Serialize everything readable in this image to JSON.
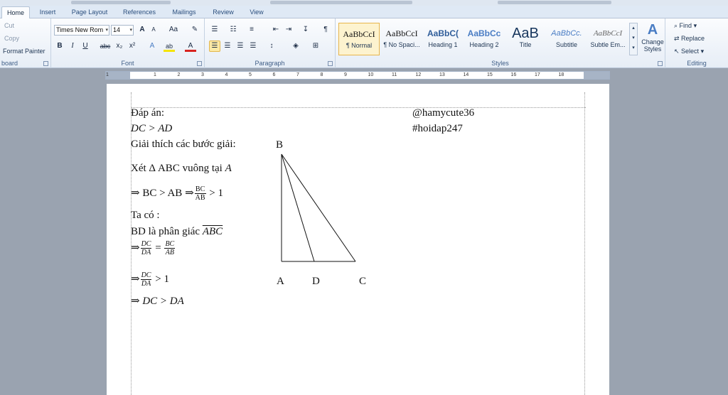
{
  "tabs": [
    "Home",
    "Insert",
    "Page Layout",
    "References",
    "Mailings",
    "Review",
    "View"
  ],
  "clipboard": {
    "cut": "Cut",
    "copy": "Copy",
    "format_painter": "Format Painter",
    "label": "board"
  },
  "font": {
    "name": "Times New Rom",
    "size": "14",
    "label": "Font",
    "grow": "A",
    "shrink": "A",
    "case": "Aa",
    "bold": "B",
    "italic": "I",
    "underline": "U",
    "strike": "abc",
    "subscript": "x₂",
    "superscript": "x²",
    "effects": "A",
    "highlight": "ab",
    "color": "A"
  },
  "paragraph": {
    "label": "Paragraph",
    "pilcrow": "¶"
  },
  "styles": {
    "label": "Styles",
    "items": [
      {
        "preview": "AaBbCcI",
        "name": "¶ Normal"
      },
      {
        "preview": "AaBbCcI",
        "name": "¶ No Spaci..."
      },
      {
        "preview": "AaBbC(",
        "name": "Heading 1"
      },
      {
        "preview": "AaBbCc",
        "name": "Heading 2"
      },
      {
        "preview": "AaB",
        "name": "Title"
      },
      {
        "preview": "AaBbCc.",
        "name": "Subtitle"
      },
      {
        "preview": "AaBbCcI",
        "name": "Subtle Em..."
      }
    ],
    "change": "Change Styles"
  },
  "editing": {
    "label": "Editing",
    "find": "Find",
    "replace": "Replace",
    "select": "Select"
  },
  "ruler": {
    "ticks": [
      "1",
      "1",
      "2",
      "3",
      "4",
      "5",
      "6",
      "7",
      "8",
      "9",
      "10",
      "11",
      "12",
      "13",
      "14",
      "15",
      "16",
      "17",
      "18"
    ]
  },
  "doc": {
    "answer_label": "Đáp án:",
    "answer_lhs": "DC",
    "answer_rhs": "AD",
    "gt": ">",
    "handle": "@hamycute36",
    "hashtag": "#hoidap247",
    "steps_title": "Giải thích các bước giải:",
    "consider": "Xét Δ ABC  vuông tại",
    "right_vertex": "A",
    "implies": "⇒",
    "ineq1": "BC > AB",
    "frac1_num": "BC",
    "frac1_den": "AB",
    "gt_one": "> 1",
    "ta_co": "Ta có :",
    "bisector": "BD là phân giác",
    "angle": "ABC",
    "frac2_num": "DC",
    "frac2_den": "DA",
    "eq": "=",
    "frac3_num": "BC",
    "frac3_den": "AB",
    "frac4_num": "DC",
    "frac4_den": "DA",
    "final": "DC > DA"
  },
  "figure": {
    "B": "B",
    "A": "A",
    "D": "D",
    "C": "C"
  }
}
